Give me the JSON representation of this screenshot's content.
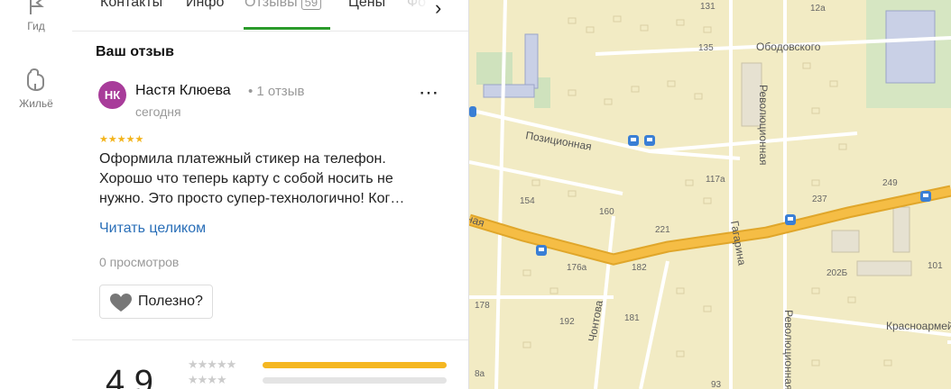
{
  "rail": {
    "items": [
      {
        "label": "Гид",
        "icon": "flag-icon"
      },
      {
        "label": "Жильё",
        "icon": "house-icon"
      }
    ]
  },
  "tabs": [
    {
      "label": "Контакты"
    },
    {
      "label": "Инфо"
    },
    {
      "label": "Отзывы",
      "count": "59",
      "active": true
    },
    {
      "label": "Цены"
    },
    {
      "label": "Фо"
    }
  ],
  "review": {
    "section_title": "Ваш отзыв",
    "avatar_initials": "НК",
    "avatar_color": "#a83c9a",
    "author": "Настя Клюева",
    "author_reviews": "• 1 отзыв",
    "date": "сегодня",
    "rating": 5,
    "stars": "★★★★★",
    "text": "Оформила платежный стикер на телефон. Хорошо что теперь карту с собой носить не нужно. Это просто супер-технологично! Ког…",
    "read_more": "Читать целиком",
    "views": "0 просмотров",
    "useful_label": "Полезно?"
  },
  "summary": {
    "rating": "4,9",
    "distribution": [
      {
        "stars": "★★★★★",
        "fraction": 1.0
      },
      {
        "stars": "★★★★",
        "fraction": 0.0
      }
    ],
    "bar_color": "#f5b721"
  },
  "map": {
    "streets": [
      "Ободовского",
      "Позиционная",
      "Революционная",
      "Гагарина",
      "Красноармейская",
      "Революционная",
      "Красная",
      "Чонтова"
    ],
    "house_numbers": [
      "131",
      "12а",
      "135",
      "117а",
      "154",
      "160",
      "221",
      "237",
      "249",
      "176а",
      "182",
      "202Б",
      "101",
      "178",
      "192",
      "181",
      "8а",
      "93"
    ]
  }
}
